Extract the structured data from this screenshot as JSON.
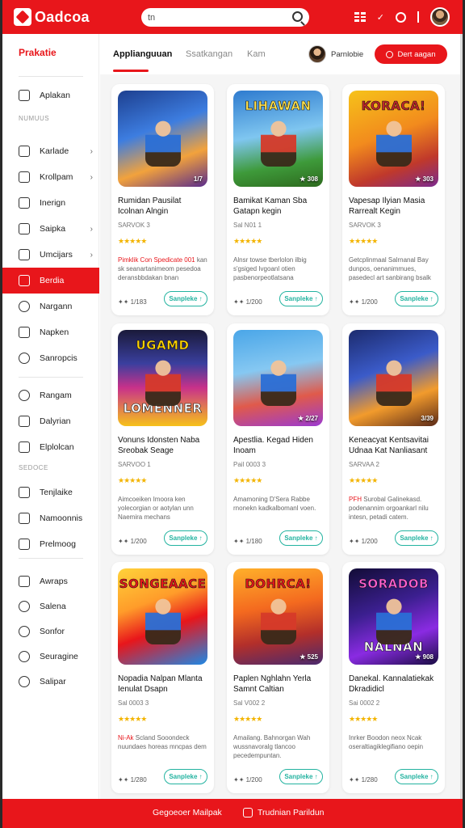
{
  "app": {
    "logo_text": "Oadcoa"
  },
  "search": {
    "value": "tn",
    "placeholder": ""
  },
  "sidebar": {
    "brand": "Prakatie",
    "section1": "NUMUUS",
    "section2": "SEDOCE",
    "items": [
      {
        "label": "Aplakan",
        "icon": "home-icon",
        "chev": false
      },
      {
        "label": "Karlade",
        "icon": "calendar-icon",
        "chev": true
      },
      {
        "label": "Krollpam",
        "icon": "tag-icon",
        "chev": true
      },
      {
        "label": "Inerign",
        "icon": "document-icon",
        "chev": false
      },
      {
        "label": "Saipka",
        "icon": "list-icon",
        "chev": true
      },
      {
        "label": "Umcijars",
        "icon": "grid-icon",
        "chev": true
      },
      {
        "label": "Berdia",
        "icon": "fire-icon",
        "chev": false,
        "active": true
      },
      {
        "label": "Nargann",
        "icon": "pin-icon",
        "chev": false
      },
      {
        "label": "Napken",
        "icon": "megaphone-icon",
        "chev": false
      },
      {
        "label": "Sanropcis",
        "icon": "search-icon",
        "chev": false
      },
      {
        "label": "Rangam",
        "icon": "target-icon",
        "chev": false
      },
      {
        "label": "Dalyrian",
        "icon": "chart-icon",
        "chev": false
      },
      {
        "label": "Elplolcan",
        "icon": "file-icon",
        "chev": false
      },
      {
        "label": "Tenjlaike",
        "icon": "book-icon",
        "chev": false
      },
      {
        "label": "Namoonnis",
        "icon": "folder-icon",
        "chev": false
      },
      {
        "label": "Prelmoog",
        "icon": "card-icon",
        "chev": false
      },
      {
        "label": "Awraps",
        "icon": "tag-icon",
        "chev": false
      },
      {
        "label": "Salena",
        "icon": "pin-icon",
        "chev": false
      },
      {
        "label": "Sonfor",
        "icon": "clock-icon",
        "chev": false
      },
      {
        "label": "Seuragine",
        "icon": "refresh-icon",
        "chev": false
      },
      {
        "label": "Salipar",
        "icon": "search-icon",
        "chev": false
      }
    ]
  },
  "tabs": [
    {
      "label": "Applianguuan",
      "active": true
    },
    {
      "label": "Ssatkangan",
      "active": false
    },
    {
      "label": "Kam",
      "active": false
    }
  ],
  "profile": {
    "name": "Parnlobie"
  },
  "cta": {
    "label": "Dert aagan"
  },
  "cards": [
    {
      "art": "",
      "badge": "1/7",
      "title": "Rumidan Pausilat Icolnan Alngin",
      "sub": "SARVOK 3",
      "stars": "★★★★★",
      "desc_hl": "Pimklik Con Spedicate 001",
      "desc": "kan sk seanartanimeom pesedoa deransbbdakan bnan",
      "meta": "✦✦ 1/183",
      "btn": "Sanpleke ↑"
    },
    {
      "art": "LIHAWAN",
      "badge": "★ 308",
      "title": "Bamikat Kaman Sba Gatapn kegin",
      "sub": "Sal N01 1",
      "stars": "★★★★★",
      "desc_hl": "",
      "desc": "Alnsr towse tberlolon ilbig s'gsiged Ivgoanl otien pasbenorpeotlatsana",
      "meta": "✦✦ 1/200",
      "btn": "Sanpleke ↑"
    },
    {
      "art": "KORACA!",
      "badge": "★ 303",
      "title": "Vapesap Ilyian Masia Rarrealt Kegin",
      "sub": "SARVOK 3",
      "stars": "★★★★★",
      "desc_hl": "",
      "desc": "Getcplinmaal Salrnanal Bay dunpos, oenanimmues, pasedecl art sanbirang bsalk",
      "meta": "✦✦ 1/200",
      "btn": "Sanpleke ↑"
    },
    {
      "art": "UGAMD",
      "art2": "LOMENNER",
      "badge": "",
      "title": "Vonuns Idonsten Naba Sreobak Seage",
      "sub": "SARVOO 1",
      "stars": "★★★★★",
      "desc_hl": "",
      "desc": "Aimcoeiken Imoora ken yolecorgian or aotylan unn Naemira mechans",
      "meta": "✦✦ 1/200",
      "btn": "Sanpleke ↑"
    },
    {
      "art": "",
      "badge": "★ 2/27",
      "title": "Apestlia. Kegad Hiden Inoam",
      "sub": "Pail 0003 3",
      "stars": "★★★★★",
      "desc_hl": "",
      "desc": "Amamoning D'Sera Rabbe rnonekn kadkalbomanl voen.",
      "meta": "✦✦ 1/180",
      "btn": "Sanpleke ↑"
    },
    {
      "art": "",
      "badge": "3/39",
      "title": "Keneacyat Kentsavitai Udnaa Kat Nanliasant",
      "sub": "SARVAA 2",
      "stars": "★★★★★",
      "desc_hl": "PFH",
      "desc": "Surobal Galinekasd. podenannim orgoankarl nilu intesn, petadi catem.",
      "meta": "✦✦ 1/200",
      "btn": "Sanpleke ↑"
    },
    {
      "art": "SONGEAACE",
      "badge": "",
      "title": "Nopadia Nalpan Mlanta Ienulat Dsapn",
      "sub": "Sal 0003 3",
      "stars": "★★★★★",
      "desc_hl": "Ni-Ak",
      "desc": "Scland Sooondeck nuundaes horeas mncpas dem",
      "meta": "✦✦ 1/280",
      "btn": "Sanpleke ↑"
    },
    {
      "art": "DOHRCA!",
      "badge": "★ 525",
      "title": "Paplen Nghlahn Yerla Samnt Caltian",
      "sub": "Sal V002 2",
      "stars": "★★★★★",
      "desc_hl": "",
      "desc": "Amailang. Bahnorgan Wah wussnavoralg tlancoo pecedempuntan.",
      "meta": "✦✦ 1/200",
      "btn": "Sanpleke ↑"
    },
    {
      "art": "SORADOB",
      "art2": "NALNAN",
      "badge": "★ 908",
      "title": "Danekal. Kannalatiekak Dkradidicl",
      "sub": "Sai 0002 2",
      "stars": "★★★★★",
      "desc_hl": "",
      "desc": "Inrker Boodon neox Ncak oseraltiagiklegifiano oepin",
      "meta": "✦✦ 1/280",
      "btn": "Sanpleke ↑"
    }
  ],
  "bottom": {
    "left_label": "Gegoeoer Mailpak",
    "right_label": "Trudnian Parildun"
  },
  "colors": {
    "brand": "#e8161b",
    "accent": "#23b3a0",
    "star": "#f3b400"
  }
}
